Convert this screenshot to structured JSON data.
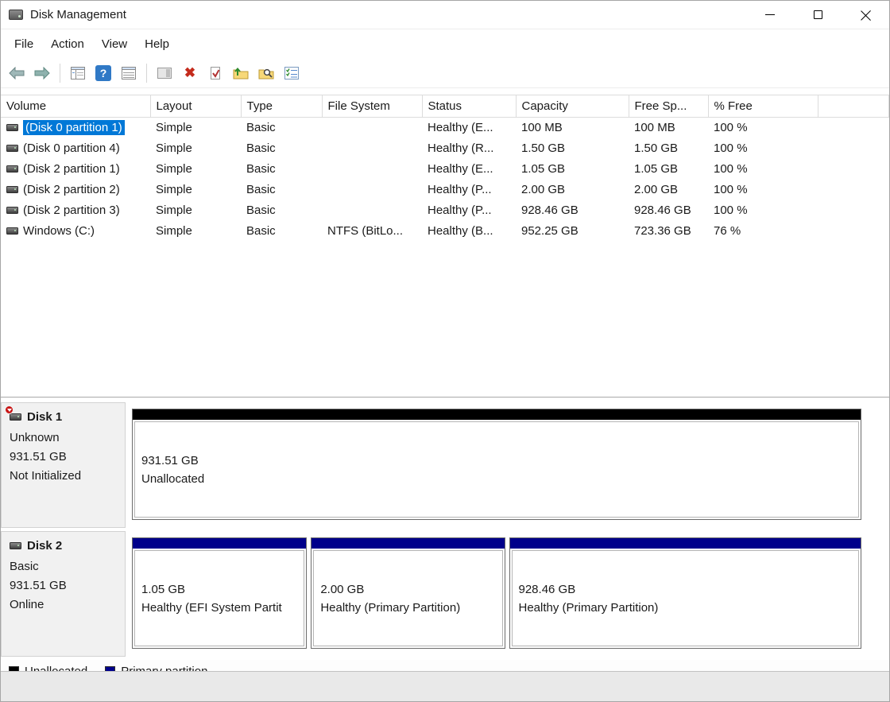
{
  "window": {
    "title": "Disk Management"
  },
  "menubar": {
    "items": [
      "File",
      "Action",
      "View",
      "Help"
    ]
  },
  "toolbar": {
    "icons": [
      "back-icon",
      "forward-icon",
      "show-console-tree-icon",
      "help-icon",
      "export-list-icon",
      "show-action-pane-icon",
      "delete-volume-icon",
      "mark-active-icon",
      "open-icon",
      "explore-icon",
      "properties-icon"
    ],
    "help_glyph": "?",
    "delete_glyph": "✖"
  },
  "volume_table": {
    "columns": [
      "Volume",
      "Layout",
      "Type",
      "File System",
      "Status",
      "Capacity",
      "Free Sp...",
      "% Free"
    ],
    "selected_volume": "(Disk 0 partition 1)",
    "rows": [
      {
        "volume": "(Disk 0 partition 1)",
        "layout": "Simple",
        "type": "Basic",
        "fs": "",
        "status": "Healthy (E...",
        "capacity": "100 MB",
        "free": "100 MB",
        "pct": "100 %"
      },
      {
        "volume": "(Disk 0 partition 4)",
        "layout": "Simple",
        "type": "Basic",
        "fs": "",
        "status": "Healthy (R...",
        "capacity": "1.50 GB",
        "free": "1.50 GB",
        "pct": "100 %"
      },
      {
        "volume": "(Disk 2 partition 1)",
        "layout": "Simple",
        "type": "Basic",
        "fs": "",
        "status": "Healthy (E...",
        "capacity": "1.05 GB",
        "free": "1.05 GB",
        "pct": "100 %"
      },
      {
        "volume": "(Disk 2 partition 2)",
        "layout": "Simple",
        "type": "Basic",
        "fs": "",
        "status": "Healthy (P...",
        "capacity": "2.00 GB",
        "free": "2.00 GB",
        "pct": "100 %"
      },
      {
        "volume": "(Disk 2 partition 3)",
        "layout": "Simple",
        "type": "Basic",
        "fs": "",
        "status": "Healthy (P...",
        "capacity": "928.46 GB",
        "free": "928.46 GB",
        "pct": "100 %"
      },
      {
        "volume": "Windows (C:)",
        "layout": "Simple",
        "type": "Basic",
        "fs": "NTFS (BitLo...",
        "status": "Healthy (B...",
        "capacity": "952.25 GB",
        "free": "723.36 GB",
        "pct": "76 %"
      }
    ]
  },
  "graphical_view": {
    "disks": [
      {
        "name": "Disk 1",
        "kind": "Unknown",
        "size": "931.51 GB",
        "state": "Not Initialized",
        "partitions": [
          {
            "size": "931.51 GB",
            "label": "Unallocated",
            "type": "unallocated"
          }
        ]
      },
      {
        "name": "Disk 2",
        "kind": "Basic",
        "size": "931.51 GB",
        "state": "Online",
        "partitions": [
          {
            "size": "1.05 GB",
            "label": "Healthy (EFI System Partit",
            "type": "primary"
          },
          {
            "size": "2.00 GB",
            "label": "Healthy (Primary Partition)",
            "type": "primary"
          },
          {
            "size": "928.46 GB",
            "label": "Healthy (Primary Partition)",
            "type": "primary"
          }
        ]
      }
    ]
  },
  "legend": {
    "items": [
      {
        "label": "Unallocated",
        "color": "#000000"
      },
      {
        "label": "Primary partition",
        "color": "#00008B"
      }
    ]
  },
  "colors": {
    "selection": "#0078D7",
    "unallocated_band": "#000000",
    "primary_band": "#00008B"
  }
}
